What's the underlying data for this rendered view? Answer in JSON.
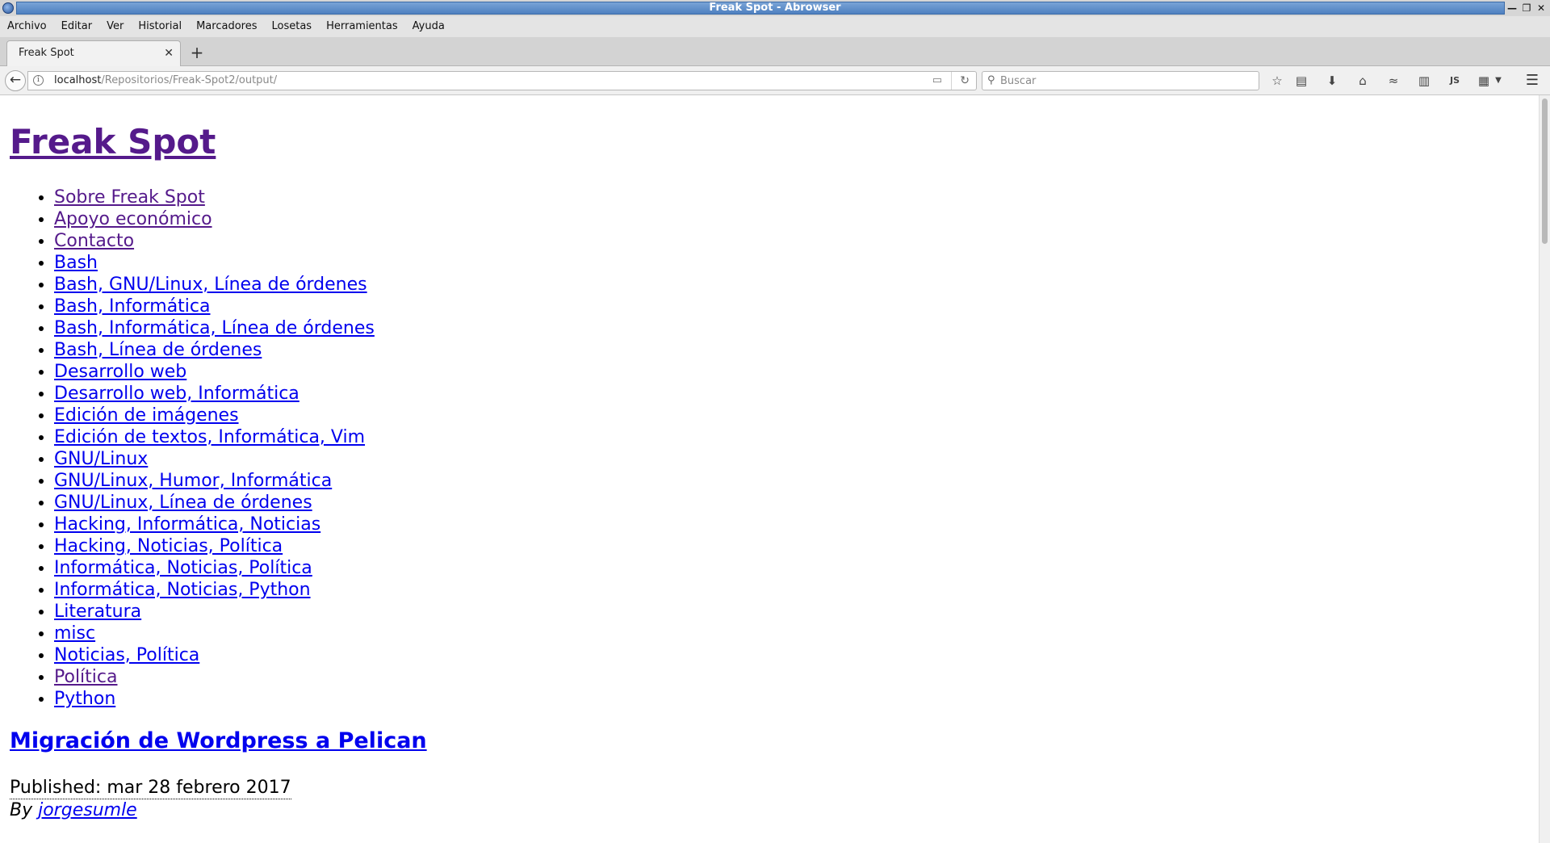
{
  "window": {
    "title": "Freak Spot - Abrowser",
    "controls": [
      "—",
      "❐",
      "✕"
    ]
  },
  "menubar": [
    "Archivo",
    "Editar",
    "Ver",
    "Historial",
    "Marcadores",
    "Losetas",
    "Herramientas",
    "Ayuda"
  ],
  "tab": {
    "label": "Freak Spot",
    "close": "✕",
    "new_tab": "+"
  },
  "navbar": {
    "back_icon": "←",
    "url_host": "localhost",
    "url_path": "/Repositorios/Freak-Spot2/output/",
    "search_placeholder": "Buscar",
    "toolbar_icons": [
      "star-icon",
      "reading-list-icon",
      "download-icon",
      "home-icon",
      "pocket-icon",
      "library-icon",
      "js-icon",
      "grid-icon",
      "dropdown-icon"
    ]
  },
  "page": {
    "site_title": "Freak Spot",
    "categories": [
      {
        "label": "Sobre Freak Spot",
        "visited": true
      },
      {
        "label": "Apoyo económico",
        "visited": true
      },
      {
        "label": "Contacto",
        "visited": true
      },
      {
        "label": "Bash",
        "visited": false
      },
      {
        "label": "Bash, GNU/Linux, Línea de órdenes",
        "visited": false
      },
      {
        "label": "Bash, Informática",
        "visited": false
      },
      {
        "label": "Bash, Informática, Línea de órdenes",
        "visited": false
      },
      {
        "label": "Bash, Línea de órdenes",
        "visited": false
      },
      {
        "label": "Desarrollo web",
        "visited": false
      },
      {
        "label": "Desarrollo web, Informática",
        "visited": false
      },
      {
        "label": "Edición de imágenes",
        "visited": false
      },
      {
        "label": "Edición de textos, Informática, Vim",
        "visited": false
      },
      {
        "label": "GNU/Linux",
        "visited": false
      },
      {
        "label": "GNU/Linux, Humor, Informática",
        "visited": false
      },
      {
        "label": "GNU/Linux, Línea de órdenes",
        "visited": false
      },
      {
        "label": "Hacking, Informática, Noticias",
        "visited": false
      },
      {
        "label": "Hacking, Noticias, Política",
        "visited": false
      },
      {
        "label": "Informática, Noticias, Política",
        "visited": false
      },
      {
        "label": "Informática, Noticias, Python",
        "visited": false
      },
      {
        "label": "Literatura",
        "visited": false
      },
      {
        "label": "misc",
        "visited": false
      },
      {
        "label": "Noticias, Política",
        "visited": false
      },
      {
        "label": "Política",
        "visited": true
      },
      {
        "label": "Python",
        "visited": false
      }
    ],
    "article": {
      "title": "Migración de Wordpress a Pelican",
      "published": "Published: mar 28 febrero 2017",
      "by_prefix": "By ",
      "author": "jorgesumle"
    }
  },
  "colors": {
    "link": "#0000ee",
    "visited": "#551a8b",
    "titlebar": "#4e80c0"
  }
}
